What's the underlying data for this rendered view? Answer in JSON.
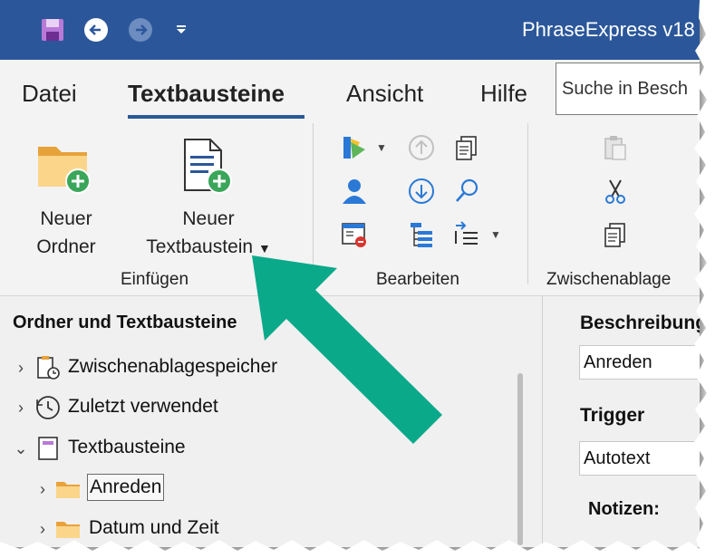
{
  "title_bar": {
    "title": "PhraseExpress v18",
    "save_icon": "save-icon",
    "back_icon": "back-arrow-icon",
    "forward_icon": "forward-arrow-icon",
    "quick_access_icon": "dropdown-triangle-icon",
    "accent": "#2b579a"
  },
  "menu": {
    "tabs": [
      "Datei",
      "Textbausteine",
      "Ansicht",
      "Hilfe"
    ],
    "active_tab": "Textbausteine",
    "search_placeholder": "Suche in Besch"
  },
  "ribbon": {
    "groups": {
      "einfuegen": {
        "label": "Einfügen",
        "new_folder": {
          "line1": "Neuer",
          "line2": "Ordner"
        },
        "new_phrase": {
          "line1": "Neuer",
          "line2": "Textbaustein"
        }
      },
      "bearbeiten": {
        "label": "Bearbeiten"
      },
      "zwischenablage": {
        "label": "Zwischenablage"
      }
    }
  },
  "tree": {
    "title": "Ordner und Textbausteine",
    "items": [
      {
        "label": "Zwischenablagespeicher",
        "icon": "clipboard-clock-icon",
        "expanded": false
      },
      {
        "label": "Zuletzt verwendet",
        "icon": "history-icon",
        "expanded": false
      },
      {
        "label": "Textbausteine",
        "icon": "phrase-book-icon",
        "expanded": true
      },
      {
        "label": "Anreden",
        "icon": "folder-icon",
        "expanded": false,
        "selected": true
      },
      {
        "label": "Datum und Zeit",
        "icon": "folder-icon",
        "expanded": false
      }
    ]
  },
  "details": {
    "description_label": "Beschreibung",
    "description_value": "Anreden",
    "trigger_label": "Trigger",
    "trigger_value": "Autotext",
    "notes_label": "Notizen:"
  },
  "annotation": {
    "arrow_color": "#0aa98a"
  }
}
